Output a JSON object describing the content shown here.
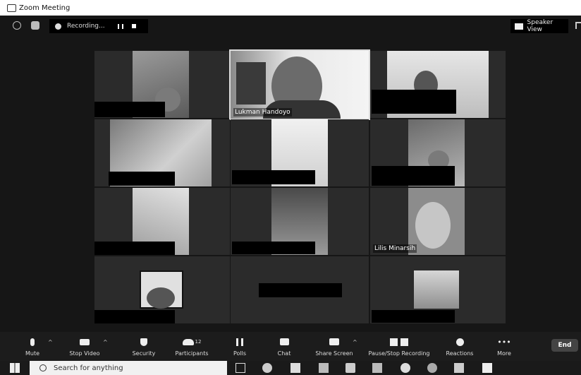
{
  "window": {
    "title": "Zoom Meeting"
  },
  "topbar": {
    "recording_label": "Recording...",
    "speaker_view_label": "Speaker View"
  },
  "tiles": [
    {
      "name": ""
    },
    {
      "name": "Lukman Handoyo"
    },
    {
      "name": ""
    },
    {
      "name": ""
    },
    {
      "name": ""
    },
    {
      "name": ""
    },
    {
      "name": ""
    },
    {
      "name": ""
    },
    {
      "name": "Lilis Minarsih"
    },
    {
      "name": ""
    },
    {
      "name": ""
    },
    {
      "name": ""
    }
  ],
  "toolbar": {
    "mute": "Mute",
    "stop_video": "Stop Video",
    "security": "Security",
    "participants": "Participants",
    "participants_count": "12",
    "polls": "Polls",
    "chat": "Chat",
    "share_screen": "Share Screen",
    "pause_stop_recording": "Pause/Stop Recording",
    "reactions": "Reactions",
    "more": "More",
    "end": "End"
  },
  "taskbar": {
    "search_placeholder": "Search for anything"
  },
  "icons": [
    "zoom-app-icon",
    "info-icon",
    "shield-icon",
    "record-icon",
    "pause-icon",
    "stop-icon",
    "speaker-view-icon",
    "fullscreen-icon",
    "microphone-icon",
    "video-camera-icon",
    "security-shield-icon",
    "participants-icon",
    "polls-icon",
    "chat-icon",
    "share-screen-icon",
    "recording-controls-icon",
    "reactions-icon",
    "more-icon",
    "windows-start-icon",
    "search-icon"
  ]
}
